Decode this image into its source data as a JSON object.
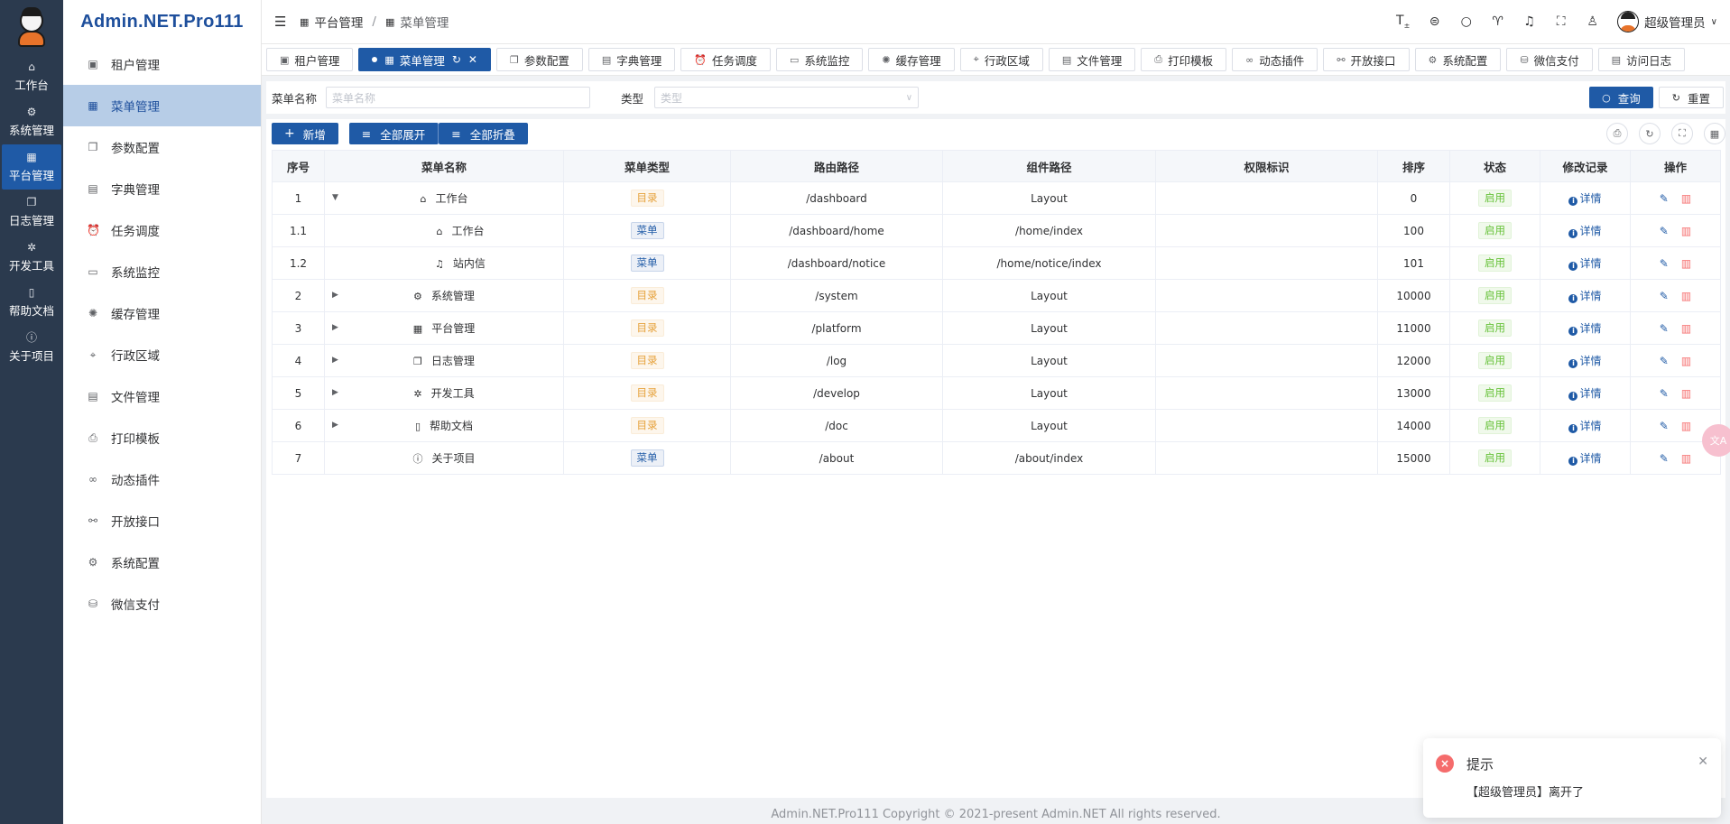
{
  "rail": {
    "items": [
      {
        "label": "工作台",
        "icon": "home-icon",
        "glyph": "⌂"
      },
      {
        "label": "系统管理",
        "icon": "gear-icon",
        "glyph": "⚙"
      },
      {
        "label": "平台管理",
        "icon": "grid-icon",
        "glyph": "▦"
      },
      {
        "label": "日志管理",
        "icon": "copy-icon",
        "glyph": "❐"
      },
      {
        "label": "开发工具",
        "icon": "chip-icon",
        "glyph": "✲"
      },
      {
        "label": "帮助文档",
        "icon": "book-icon",
        "glyph": "▯"
      },
      {
        "label": "关于项目",
        "icon": "info-icon",
        "glyph": "ⓘ"
      }
    ]
  },
  "brand": "Admin.NET.Pro111",
  "submenu": {
    "items": [
      {
        "label": "租户管理",
        "icon": "building-icon",
        "glyph": "▣"
      },
      {
        "label": "菜单管理",
        "icon": "grid-icon",
        "glyph": "▦"
      },
      {
        "label": "参数配置",
        "icon": "copy-icon",
        "glyph": "❐"
      },
      {
        "label": "字典管理",
        "icon": "save-icon",
        "glyph": "▤"
      },
      {
        "label": "任务调度",
        "icon": "alarm-icon",
        "glyph": "⏰"
      },
      {
        "label": "系统监控",
        "icon": "monitor-icon",
        "glyph": "▭"
      },
      {
        "label": "缓存管理",
        "icon": "loading-icon",
        "glyph": "✺"
      },
      {
        "label": "行政区域",
        "icon": "location-icon",
        "glyph": "⌖"
      },
      {
        "label": "文件管理",
        "icon": "document-icon",
        "glyph": "▤"
      },
      {
        "label": "打印模板",
        "icon": "printer-icon",
        "glyph": "⎙"
      },
      {
        "label": "动态插件",
        "icon": "plugin-icon",
        "glyph": "∞"
      },
      {
        "label": "开放接口",
        "icon": "link-icon",
        "glyph": "⚯"
      },
      {
        "label": "系统配置",
        "icon": "settings-icon",
        "glyph": "⚙"
      },
      {
        "label": "微信支付",
        "icon": "coin-icon",
        "glyph": "⛁"
      }
    ]
  },
  "header": {
    "breadcrumb": [
      "平台管理",
      "菜单管理"
    ],
    "user": "超级管理员"
  },
  "tabs": [
    {
      "label": "租户管理",
      "glyph": "▣"
    },
    {
      "label": "菜单管理",
      "glyph": "▦"
    },
    {
      "label": "参数配置",
      "glyph": "❐"
    },
    {
      "label": "字典管理",
      "glyph": "▤"
    },
    {
      "label": "任务调度",
      "glyph": "⏰"
    },
    {
      "label": "系统监控",
      "glyph": "▭"
    },
    {
      "label": "缓存管理",
      "glyph": "✺"
    },
    {
      "label": "行政区域",
      "glyph": "⌖"
    },
    {
      "label": "文件管理",
      "glyph": "▤"
    },
    {
      "label": "打印模板",
      "glyph": "⎙"
    },
    {
      "label": "动态插件",
      "glyph": "∞"
    },
    {
      "label": "开放接口",
      "glyph": "⚯"
    },
    {
      "label": "系统配置",
      "glyph": "⚙"
    },
    {
      "label": "微信支付",
      "glyph": "⛁"
    },
    {
      "label": "访问日志",
      "glyph": "▤"
    }
  ],
  "search": {
    "name_label": "菜单名称",
    "name_placeholder": "菜单名称",
    "type_label": "类型",
    "type_placeholder": "类型",
    "query_label": "查询",
    "reset_label": "重置"
  },
  "toolbar": {
    "add_label": "新增",
    "expand_label": "全部展开",
    "collapse_label": "全部折叠"
  },
  "table": {
    "columns": [
      "序号",
      "菜单名称",
      "菜单类型",
      "路由路径",
      "组件路径",
      "权限标识",
      "排序",
      "状态",
      "修改记录",
      "操作"
    ],
    "rows": [
      {
        "no": "1",
        "name": "工作台",
        "icon": "home-icon",
        "glyph": "⌂",
        "arrow": "down",
        "indent": 0,
        "type": "目录",
        "path": "/dashboard",
        "component": "Layout",
        "perm": "",
        "order": "0",
        "status": "启用",
        "detail": "详情"
      },
      {
        "no": "1.1",
        "name": "工作台",
        "icon": "home-icon",
        "glyph": "⌂",
        "arrow": "",
        "indent": 1,
        "type": "菜单",
        "path": "/dashboard/home",
        "component": "/home/index",
        "perm": "",
        "order": "100",
        "status": "启用",
        "detail": "详情"
      },
      {
        "no": "1.2",
        "name": "站内信",
        "icon": "bell-icon",
        "glyph": "♫",
        "arrow": "",
        "indent": 1,
        "type": "菜单",
        "path": "/dashboard/notice",
        "component": "/home/notice/index",
        "perm": "",
        "order": "101",
        "status": "启用",
        "detail": "详情"
      },
      {
        "no": "2",
        "name": "系统管理",
        "icon": "gear-icon",
        "glyph": "⚙",
        "arrow": "right",
        "indent": 0,
        "type": "目录",
        "path": "/system",
        "component": "Layout",
        "perm": "",
        "order": "10000",
        "status": "启用",
        "detail": "详情"
      },
      {
        "no": "3",
        "name": "平台管理",
        "icon": "grid-icon",
        "glyph": "▦",
        "arrow": "right",
        "indent": 0,
        "type": "目录",
        "path": "/platform",
        "component": "Layout",
        "perm": "",
        "order": "11000",
        "status": "启用",
        "detail": "详情"
      },
      {
        "no": "4",
        "name": "日志管理",
        "icon": "copy-icon",
        "glyph": "❐",
        "arrow": "right",
        "indent": 0,
        "type": "目录",
        "path": "/log",
        "component": "Layout",
        "perm": "",
        "order": "12000",
        "status": "启用",
        "detail": "详情"
      },
      {
        "no": "5",
        "name": "开发工具",
        "icon": "chip-icon",
        "glyph": "✲",
        "arrow": "right",
        "indent": 0,
        "type": "目录",
        "path": "/develop",
        "component": "Layout",
        "perm": "",
        "order": "13000",
        "status": "启用",
        "detail": "详情"
      },
      {
        "no": "6",
        "name": "帮助文档",
        "icon": "book-icon",
        "glyph": "▯",
        "arrow": "right",
        "indent": 0,
        "type": "目录",
        "path": "/doc",
        "component": "Layout",
        "perm": "",
        "order": "14000",
        "status": "启用",
        "detail": "详情"
      },
      {
        "no": "7",
        "name": "关于项目",
        "icon": "info-icon",
        "glyph": "ⓘ",
        "arrow": "",
        "indent": 0,
        "type": "菜单",
        "path": "/about",
        "component": "/about/index",
        "perm": "",
        "order": "15000",
        "status": "启用",
        "detail": "详情"
      }
    ]
  },
  "notification": {
    "title": "提示",
    "message": "【超级管理员】离开了"
  },
  "footer": "Admin.NET.Pro111 Copyright © 2021-present Admin.NET All rights reserved."
}
